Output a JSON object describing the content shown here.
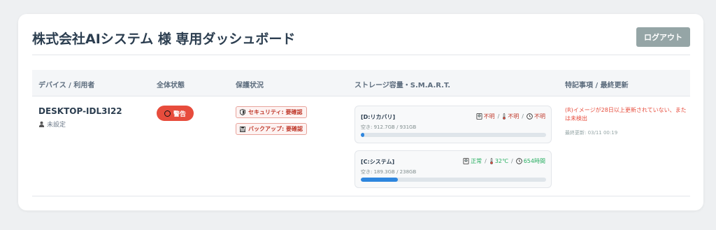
{
  "header": {
    "title": "株式会社AIシステム 様 専用ダッシュボード",
    "logout_label": "ログアウト"
  },
  "table": {
    "columns": [
      "デバイス / 利用者",
      "全体状態",
      "保護状況",
      "ストレージ容量・S.M.A.R.T.",
      "特記事項 / 最終更新"
    ]
  },
  "row": {
    "device": "DESKTOP-IDL3I22",
    "user": "未設定",
    "status": "警告",
    "protection": [
      {
        "label": "セキュリティ: 要確認",
        "icon": "shield-icon"
      },
      {
        "label": "バックアップ: 要確認",
        "icon": "floppy-icon"
      }
    ],
    "drives": [
      {
        "name": "[D:リカバリ]",
        "health": "不明",
        "temp": "不明",
        "hours": "不明",
        "free": "空き: 912.7GB / 931GB",
        "used_fraction": 0.02,
        "color": "#c0392b"
      },
      {
        "name": "[C:システム]",
        "health": "正常",
        "temp": "32℃",
        "hours": "654時間",
        "free": "空き: 189.3GB / 238GB",
        "used_fraction": 0.2,
        "color": "#27ae60"
      }
    ],
    "note": "(R)イメージが28日以上更新されていない、または未検出",
    "updated": "最終更新: 03/11 00:19"
  },
  "colors": {
    "accent": "#2e86de",
    "warning": "#e74c3c",
    "logout": "#95a5a6"
  }
}
